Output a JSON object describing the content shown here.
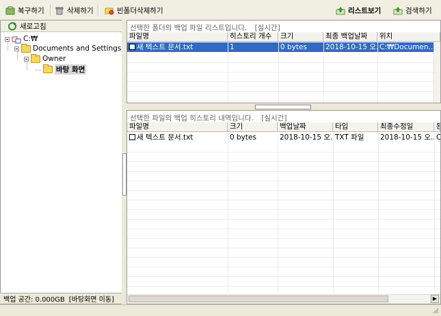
{
  "toolbar": {
    "restore": "복구하기",
    "delete": "삭제하기",
    "delete_empty": "빈폴더삭제하기",
    "list_view": "리스트보기",
    "search": "검색하기"
  },
  "tree": {
    "refresh": "새로고침",
    "drive": "C:₩",
    "documents": "Documents and Settings",
    "owner": "Owner",
    "desktop": "바탕 화면"
  },
  "status": {
    "backup_space": "백업 공간: 0.000GB",
    "move": "[바탕화면 이동]"
  },
  "top_panel": {
    "title": "선택한 폴더의 백업 파일 리스트입니다.",
    "realtime": "[실시간]",
    "columns": [
      "파일명",
      "히스토리 개수",
      "크기",
      "최종 백업날짜",
      "위치"
    ],
    "rows": [
      [
        "새 텍스트 문서.txt",
        "1",
        "0 bytes",
        "2018-10-15 오...",
        "C:₩Documen..."
      ]
    ]
  },
  "bottom_panel": {
    "title": "선택한 파일의 백업 히스토리 내역입니다.",
    "realtime": "[실시간]",
    "columns": [
      "파일명",
      "크기",
      "백업날짜",
      "타입",
      "최종수정일",
      "된"
    ],
    "rows": [
      [
        "새 텍스트 문서.txt",
        "0 bytes",
        "2018-10-15 오...",
        "TXT 파일",
        "2018-10-15 오...",
        "C"
      ]
    ]
  }
}
